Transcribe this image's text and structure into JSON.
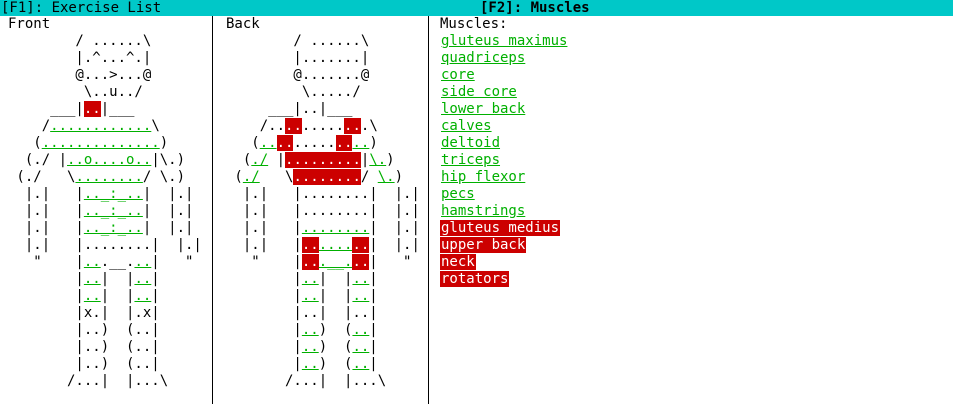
{
  "tabs": {
    "exercise_list": "[F1]: Exercise List",
    "muscles": "[F2]: Muscles"
  },
  "views": {
    "front_label": "Front",
    "back_label": "Back"
  },
  "muscles": {
    "heading": "Muscles:",
    "items": [
      {
        "label": "gluteus maximus",
        "state": "worked"
      },
      {
        "label": "quadriceps",
        "state": "worked"
      },
      {
        "label": "core",
        "state": "worked"
      },
      {
        "label": "side core",
        "state": "worked"
      },
      {
        "label": "lower back",
        "state": "worked"
      },
      {
        "label": "calves",
        "state": "worked"
      },
      {
        "label": "deltoid",
        "state": "worked"
      },
      {
        "label": "triceps",
        "state": "worked"
      },
      {
        "label": "hip flexor",
        "state": "worked"
      },
      {
        "label": "pecs",
        "state": "worked"
      },
      {
        "label": "hamstrings",
        "state": "worked"
      },
      {
        "label": "gluteus medius",
        "state": "not-worked"
      },
      {
        "label": "upper back",
        "state": "not-worked"
      },
      {
        "label": "neck",
        "state": "not-worked"
      },
      {
        "label": "rotators",
        "state": "not-worked"
      }
    ]
  },
  "colors": {
    "titlebar": "#00c8c8",
    "worked": "#00b000",
    "not_worked": "#cc0000"
  }
}
